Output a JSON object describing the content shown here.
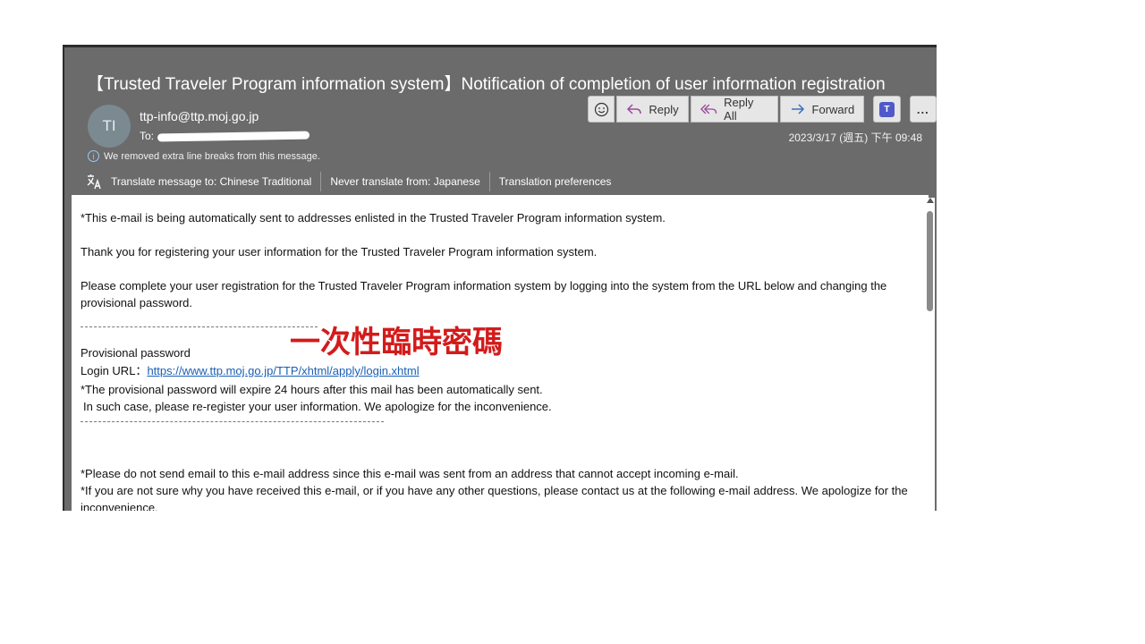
{
  "email": {
    "subject": "【Trusted Traveler Program information system】Notification of completion of user information registration",
    "sender_initials": "TI",
    "sender": "ttp-info@ttp.moj.go.jp",
    "to_label": "To:",
    "date": "2023/3/17 (週五) 下午 09:48",
    "notice": "We removed extra line breaks from this message."
  },
  "toolbar": {
    "reply_label": "Reply",
    "reply_all_label": "Reply All",
    "forward_label": "Forward",
    "more_label": "..."
  },
  "translate": {
    "translate_label": "Translate message to: Chinese Traditional",
    "never_label": "Never translate from: Japanese",
    "prefs_label": "Translation preferences"
  },
  "body": {
    "line1": "*This e-mail is being automatically sent to addresses enlisted in the Trusted Traveler Program information system.",
    "line2": "Thank you for registering your user information for the Trusted Traveler Program information system.",
    "line3": "Please complete your user registration for the Trusted Traveler Program information system by logging into the system from the URL below and changing the provisional password.",
    "password_label": "Provisional password",
    "password_overlay": "一次性臨時密碼",
    "url_label": "Login URL：",
    "url": "https://www.ttp.moj.go.jp/TTP/xhtml/apply/login.xhtml",
    "expire": "*The provisional password will expire 24 hours after this mail has been automatically sent.",
    "sorry": "In such case, please re-register your user information. We apologize for the inconvenience.",
    "no_send": "*Please do not send email to this e-mail address since this e-mail was sent from an address that cannot accept incoming e-mail.",
    "if_not": "*If you are not sure why you have received this e-mail, or if you have any other questions,  please contact us at the following e-mail address. We apologize for the inconvenience."
  },
  "colors": {
    "header_bg": "#6b6b6b",
    "overlay_red": "#d31b1b",
    "link_blue": "#1a5fb4"
  }
}
